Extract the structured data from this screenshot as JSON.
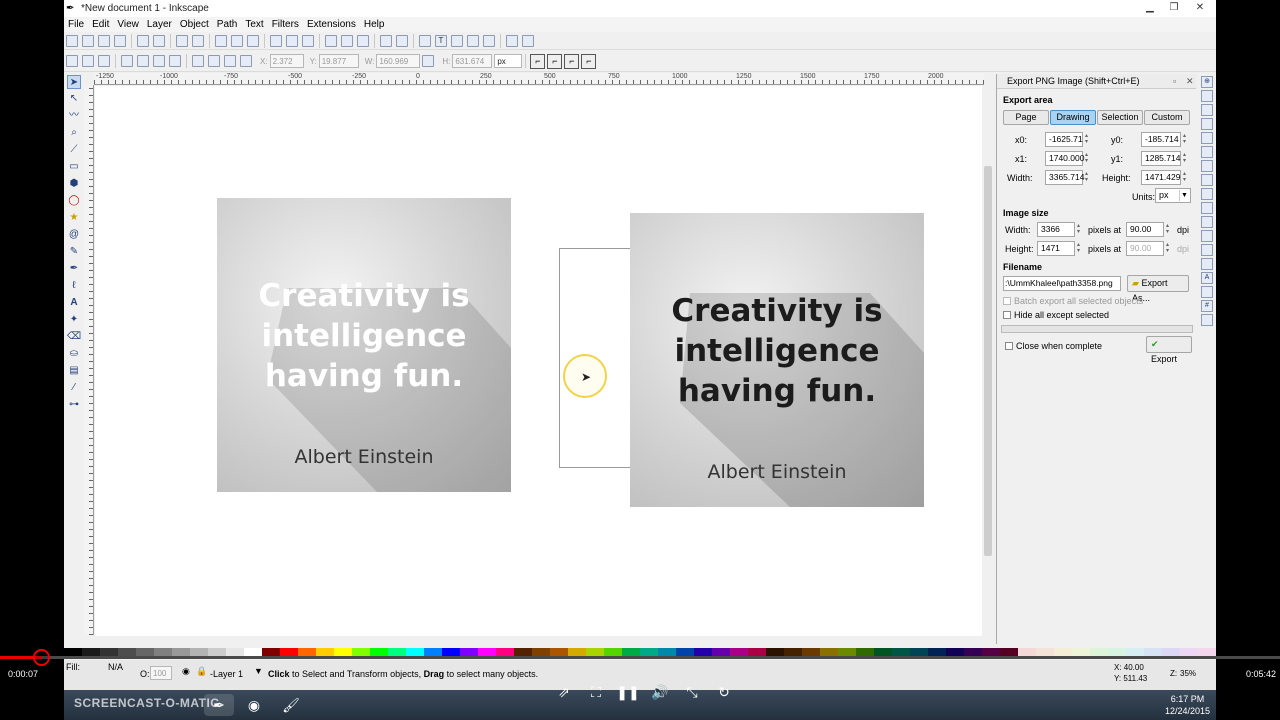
{
  "window": {
    "title": "*New document 1 - Inkscape"
  },
  "menu": [
    "File",
    "Edit",
    "View",
    "Layer",
    "Object",
    "Path",
    "Text",
    "Filters",
    "Extensions",
    "Help"
  ],
  "toolbar2": {
    "x_label": "X:",
    "x": "2.372",
    "y_label": "Y:",
    "y": "19.877",
    "w_label": "W:",
    "w": "160.969",
    "h_label": "H:",
    "h": "631.674",
    "unit": "px"
  },
  "ruler_ticks": [
    "-1250",
    "-1000",
    "-750",
    "-500",
    "-250",
    "0",
    "250",
    "500",
    "750",
    "1000",
    "1250",
    "1500",
    "1750",
    "2000"
  ],
  "canvas": {
    "card1": {
      "quote_lines": [
        "Creativity is",
        "intelligence",
        "having fun."
      ],
      "author": "Albert Einstein"
    },
    "card2": {
      "quote_lines": [
        "Creativity is",
        "intelligence",
        "having fun."
      ],
      "author": "Albert Einstein"
    }
  },
  "export": {
    "title": "Export PNG Image (Shift+Ctrl+E)",
    "area_heading": "Export area",
    "area_buttons": [
      "Page",
      "Drawing",
      "Selection",
      "Custom"
    ],
    "active_area": "Drawing",
    "x0_label": "x0:",
    "x0": "-1625.71",
    "y0_label": "y0:",
    "y0": "-185.714",
    "x1_label": "x1:",
    "x1": "1740.000",
    "y1_label": "y1:",
    "y1": "1285.714",
    "width_label": "Width:",
    "width": "3365.714",
    "height_label": "Height:",
    "height": "1471.429",
    "units_label": "Units:",
    "units": "px",
    "size_heading": "Image size",
    "img_width_label": "Width:",
    "img_width": "3366",
    "img_height_label": "Height:",
    "img_height": "1471",
    "pixels_at": "pixels at",
    "dpi1": "90.00",
    "dpi2": "90.00",
    "dpi_label": "dpi",
    "filename_heading": "Filename",
    "filename": ":\\UmmKhaleel\\path3358.png",
    "export_as": "Export As...",
    "batch_label": "Batch export all selected objects",
    "hide_label": "Hide all except selected",
    "close_label": "Close when complete",
    "export_button": "Export"
  },
  "status": {
    "fill_label": "Fill:",
    "fill_value": "N/A",
    "opacity_label": "O:",
    "opacity": "100",
    "layer": "-Layer 1",
    "message_bold1": "Click",
    "message_mid": " to Select and Transform objects, ",
    "message_bold2": "Drag",
    "message_end": " to select many objects.",
    "x_coord": "X: 40.00",
    "y_coord": "Y: 511.43",
    "zoom_label": "Z:",
    "zoom": "35%"
  },
  "video": {
    "elapsed": "0:00:07",
    "total": "0:05:42"
  },
  "taskbar": {
    "brand": "SCREENCAST-O-MATIC",
    "time": "6:17 PM",
    "date": "12/24/2015"
  },
  "colors": {
    "accent": "#a9d3f3",
    "recording": "#e00000"
  }
}
